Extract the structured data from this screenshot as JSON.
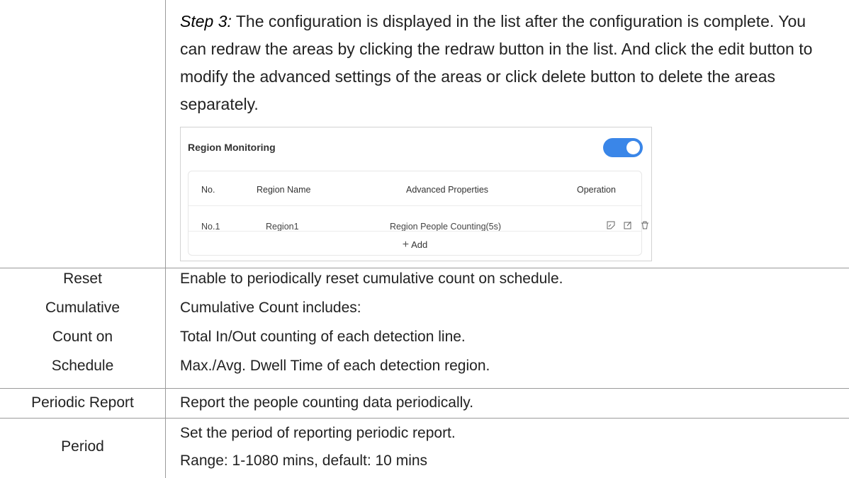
{
  "step3": {
    "lead": "Step 3:",
    "text": " The configuration is displayed in the list after the configuration is complete. You can redraw the areas by clicking the redraw button in the list. And click the edit button to modify the advanced settings of the areas or click delete button to delete the areas separately."
  },
  "panel": {
    "title": "Region Monitoring",
    "toggle_on": true,
    "accent": "#3a86e8",
    "headers": [
      "No.",
      "Region Name",
      "Advanced Properties",
      "Operation"
    ],
    "rows": [
      {
        "no": "No.1",
        "name": "Region1",
        "props": "Region People Counting(5s)"
      }
    ],
    "op_icons": [
      "redraw-icon",
      "edit-icon",
      "delete-icon"
    ],
    "add_label": "Add"
  },
  "table": {
    "reset": {
      "label_lines": [
        "Reset",
        "Cumulative",
        "Count on",
        "Schedule"
      ],
      "desc_lines": [
        "Enable to periodically reset cumulative count on schedule.",
        "Cumulative Count includes:",
        "Total In/Out counting of each detection line.",
        "Max./Avg. Dwell Time of each detection region."
      ]
    },
    "periodic": {
      "label": "Periodic Report",
      "desc": "Report the people counting data periodically."
    },
    "period": {
      "label": "Period",
      "desc_lines": [
        "Set the period of reporting periodic report.",
        "Range: 1-1080 mins, default: 10 mins"
      ]
    }
  }
}
